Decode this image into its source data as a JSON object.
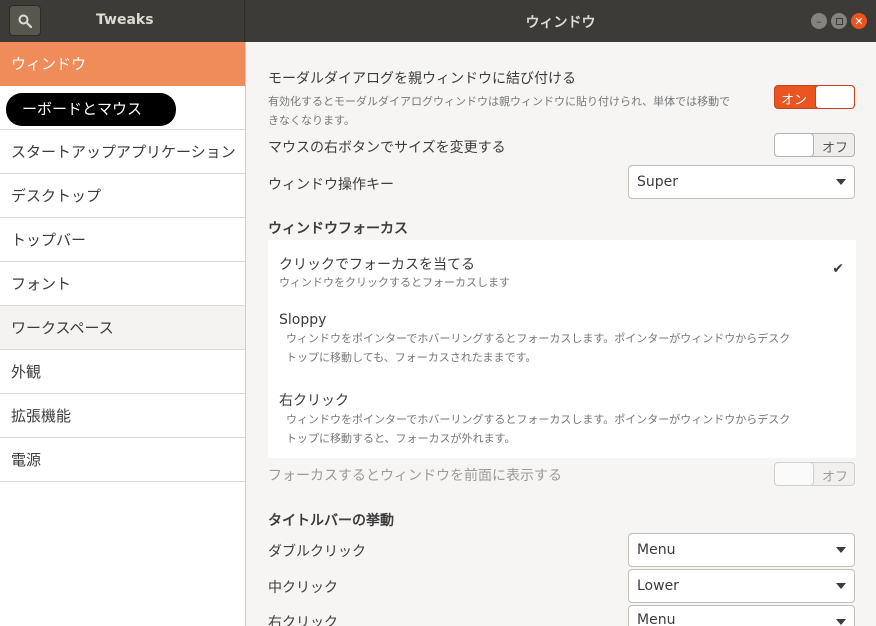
{
  "header": {
    "app_title": "Tweaks",
    "window_title": "ウィンドウ",
    "search_icon": "search-icon",
    "controls": [
      "minimize-icon",
      "maximize-icon",
      "close-icon"
    ]
  },
  "sidebar": {
    "items": [
      {
        "label": "ウィンドウ"
      },
      {
        "label": "キーボードとマウス"
      },
      {
        "label": "スタートアップアプリケーション"
      },
      {
        "label": "デスクトップ"
      },
      {
        "label": "トップバー"
      },
      {
        "label": "フォント"
      },
      {
        "label": "ワークスペース"
      },
      {
        "label": "外観"
      },
      {
        "label": "拡張機能"
      },
      {
        "label": "電源"
      }
    ],
    "redacted_visible": "ーボードとマウス"
  },
  "main": {
    "modal": {
      "title": "モーダルダイアログを親ウィンドウに結び付ける",
      "desc1": "有効化するとモーダルダイアログウィンドウは親ウィンドウに貼り付けられ、単体では移動で",
      "desc2": "きなくなります。",
      "switch_label": "オン"
    },
    "resize": {
      "title": "マウスの右ボタンでサイズを変更する",
      "switch_label": "オフ"
    },
    "action_key": {
      "title": "ウィンドウ操作キー",
      "value": "Super"
    },
    "focus": {
      "section_title": "ウィンドウフォーカス",
      "options": [
        {
          "title": "クリックでフォーカスを当てる",
          "desc1": "ウィンドウをクリックするとフォーカスします",
          "desc2": ""
        },
        {
          "title": "Sloppy",
          "desc1": "ウィンドウをポインターでホバーリングするとフォーカスします。ポインターがウィンドウからデスク",
          "desc2": "トップに移動しても、フォーカスされたままです。"
        },
        {
          "title": "右クリック",
          "desc1": "ウィンドウをポインターでホバーリングするとフォーカスします。ポインターがウィンドウからデスク",
          "desc2": "トップに移動すると、フォーカスが外れます。"
        }
      ],
      "raise_title": "フォーカスするとウィンドウを前面に表示する",
      "raise_switch_label": "オフ",
      "check_glyph": "✔"
    },
    "titlebar": {
      "section_title": "タイトルバーの挙動",
      "rows": [
        {
          "title": "ダブルクリック",
          "value": "Menu"
        },
        {
          "title": "中クリック",
          "value": "Lower"
        },
        {
          "title": "右クリック",
          "value": "Menu"
        }
      ]
    }
  }
}
